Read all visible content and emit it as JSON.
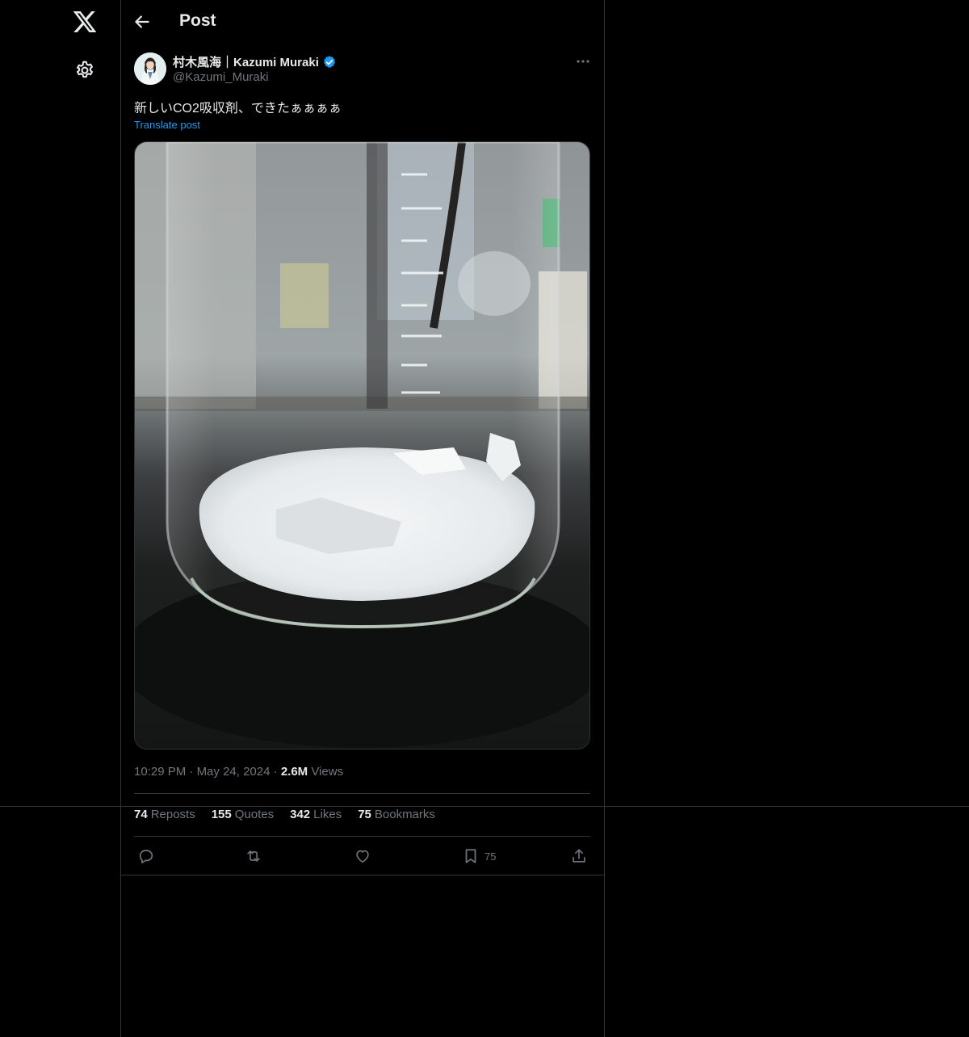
{
  "nav": {
    "logo_icon": "x-logo-icon",
    "settings_icon": "gear-icon"
  },
  "header": {
    "back_icon": "arrow-left-icon",
    "title": "Post"
  },
  "post": {
    "author_name": "村木風海｜Kazumi Muraki",
    "author_handle": "@Kazumi_Muraki",
    "verified": true,
    "text": "新しいCO2吸収剤、できたぁぁぁぁ",
    "translate_label": "Translate post",
    "media_icon": "photo-beaker-with-white-crystals",
    "time": "10:29 PM",
    "date": "May 24, 2024",
    "views_count": "2.6M",
    "views_label": "Views"
  },
  "stats": {
    "reposts_count": "74",
    "reposts_label": "Reposts",
    "quotes_count": "155",
    "quotes_label": "Quotes",
    "likes_count": "342",
    "likes_label": "Likes",
    "bookmarks_count": "75",
    "bookmarks_label": "Bookmarks"
  },
  "actions": {
    "bookmark_count": "75"
  },
  "colors": {
    "background": "#000000",
    "text": "#e7e9ea",
    "muted": "#71767b",
    "accent": "#1d9bf0",
    "border": "#2f3336"
  }
}
